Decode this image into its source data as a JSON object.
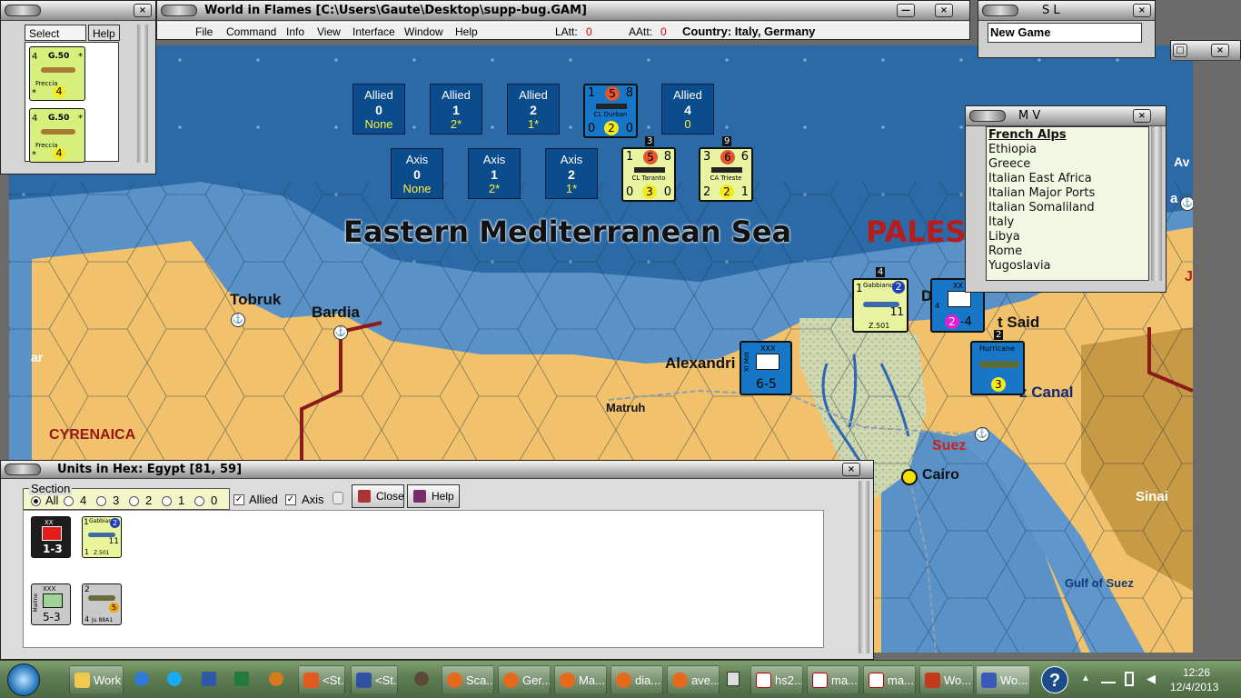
{
  "main_window": {
    "title": "World in Flames [C:\\Users\\Gaute\\Desktop\\supp-bug.GAM]",
    "menu": [
      "File",
      "Command",
      "Info",
      "View",
      "Interface",
      "Window",
      "Help"
    ],
    "latt_label": "LAtt:",
    "latt_value": "0",
    "aatt_label": "AAtt:",
    "aatt_value": "0",
    "country_label": "Country: Italy, Germany"
  },
  "select_window": {
    "tab_select": "Select",
    "tab_help": "Help",
    "units": [
      {
        "top_left": "4",
        "type": "G.50",
        "name": "Freccia",
        "bottom_left": "*",
        "factor": "4",
        "mark": "*"
      },
      {
        "top_left": "4",
        "type": "G.50",
        "name": "Freccia",
        "bottom_left": "*",
        "factor": "4",
        "mark": "*"
      }
    ]
  },
  "sl_window": {
    "title": "S L",
    "item": "New Game"
  },
  "mv_window": {
    "title": "M V",
    "items": [
      "French Alps",
      "Ethiopia",
      "Greece",
      "Italian East Africa",
      "Italian Major Ports",
      "Italian Somaliland",
      "Italy",
      "Libya",
      "Rome",
      "Yugoslavia"
    ]
  },
  "map": {
    "sea_name": "Eastern Mediterranean Sea",
    "palestine": "PALES",
    "places": {
      "tobruk": "Tobruk",
      "bardia": "Bardia",
      "alexandria": "Alexandri",
      "matruh": "Matruh",
      "cyrenaica": "CYRENAICA",
      "suez": "Suez",
      "cairo": "Cairo",
      "sinai": "Sinai",
      "gulf_of_suez": "Gulf of Suez",
      "suez_canal": "z Canal",
      "port_said": "t Said",
      "left_edge": "ar",
      "right_av": "Av",
      "right_a": "a",
      "right_j": "J",
      "d": "D"
    },
    "allied_boxes": [
      {
        "side": "Allied",
        "num": "0",
        "sub": "None"
      },
      {
        "side": "Allied",
        "num": "1",
        "sub": "2*"
      },
      {
        "side": "Allied",
        "num": "2",
        "sub": "1*"
      },
      {
        "side": "Allied",
        "num": "4",
        "sub": "0"
      }
    ],
    "axis_boxes": [
      {
        "side": "Axis",
        "num": "0",
        "sub": "None"
      },
      {
        "side": "Axis",
        "num": "1",
        "sub": "2*"
      },
      {
        "side": "Axis",
        "num": "2",
        "sub": "1*"
      }
    ],
    "ships": {
      "durban": {
        "name": "CL Durban",
        "tl": "1",
        "att": "5",
        "tr": "8",
        "bl": "0",
        "def": "2",
        "br": "0"
      },
      "taranto": {
        "name": "CL Taranto",
        "tl": "1",
        "att": "5",
        "tr": "8",
        "bl": "0",
        "def": "3",
        "br": "0",
        "stack": "3"
      },
      "trieste": {
        "name": "CA Trieste",
        "tl": "3",
        "att": "6",
        "tr": "6",
        "bl": "2",
        "def": "2",
        "br": "1",
        "stack": "9"
      }
    },
    "gabbiano": {
      "name": "Gabbiano",
      "tl": "1",
      "badge": "2",
      "val": "11",
      "bot": "Z.501",
      "stack": "4"
    },
    "hurricane": {
      "name": "Hurricane",
      "val": "3",
      "stack": "2"
    },
    "xi_mot": {
      "size": "XXX",
      "side": "XI Mot",
      "strength": "6-5"
    },
    "para": {
      "size": "XX",
      "badge": "2",
      "strength": "-4",
      "side": "4"
    }
  },
  "units_in_hex": {
    "title": "Units in Hex: Egypt [81, 59]",
    "section_label": "Section",
    "radios": [
      "All",
      "4",
      "3",
      "2",
      "1",
      "0"
    ],
    "allied_label": "Allied",
    "axis_label": "Axis",
    "close_label": "Close",
    "help_label": "Help",
    "units": {
      "infantry": {
        "size": "XX",
        "strength": "1-3"
      },
      "gabbiano": {
        "tl": "1",
        "name": "Gabbiano",
        "badge": "2",
        "val": "11",
        "bot": "Z.501",
        "bl": "1"
      },
      "marine": {
        "size": "XXX",
        "side": "Marine",
        "strength": "5-3"
      },
      "ju88": {
        "tl": "2",
        "val": "5",
        "bl": "4",
        "name": "Ju 88A1"
      }
    }
  },
  "taskbar": {
    "buttons": [
      "Work",
      "<St...",
      "<St...",
      "Sca...",
      "Ger...",
      "Ma...",
      "dia...",
      "ave...",
      "hs2...",
      "ma...",
      "ma...",
      "Wo...",
      "Wo..."
    ],
    "time": "12:26",
    "date": "12/4/2013"
  },
  "colors": {
    "sea": "#2b6aa7",
    "land": "#f1c26b",
    "counter_blue": "#1677c9",
    "counter_yellow": "#e8f4a0",
    "box_blue": "#0b4c8c",
    "palestine_red": "#b81b1b",
    "taskbar": "#5d7c52"
  }
}
